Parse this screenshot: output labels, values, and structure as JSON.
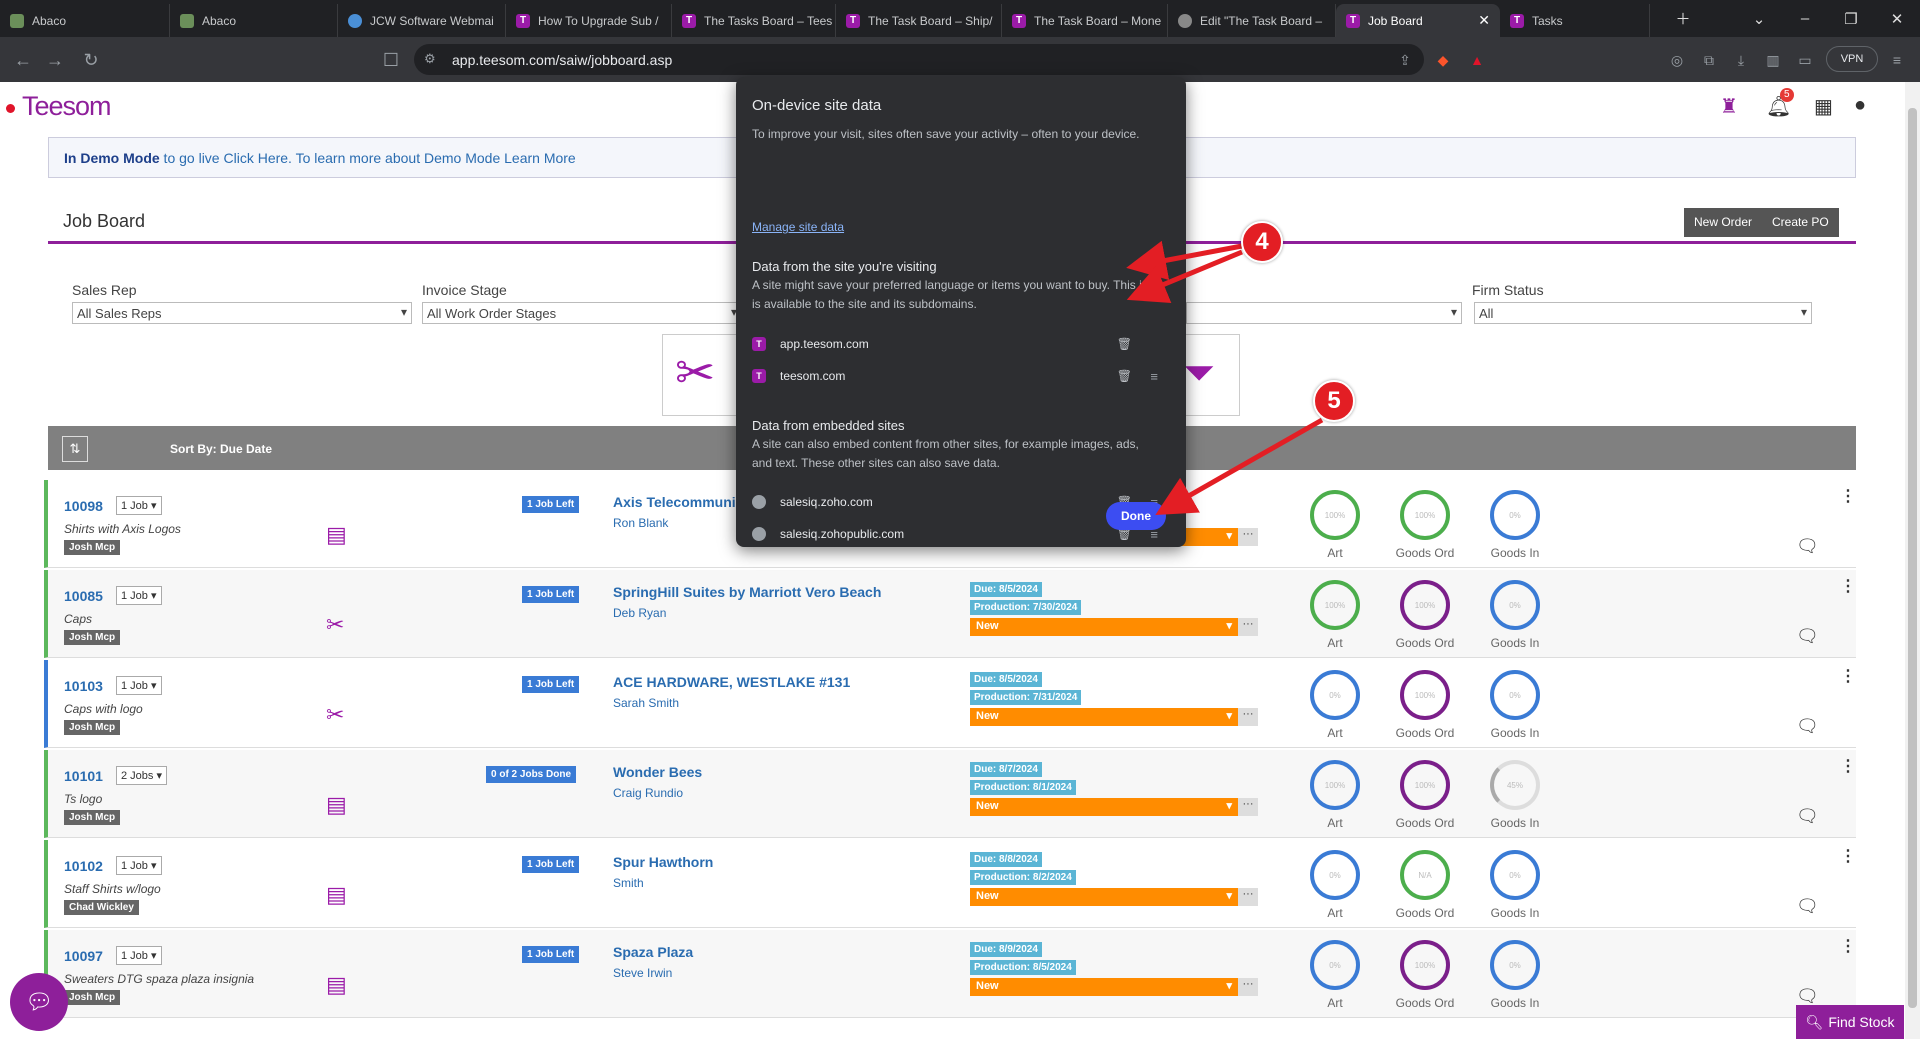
{
  "browser": {
    "tabs": [
      {
        "label": "Abaco",
        "icon": "g"
      },
      {
        "label": "Abaco",
        "icon": "g"
      },
      {
        "label": "JCW Software Webmai",
        "icon": "w"
      },
      {
        "label": "How To Upgrade Sub /",
        "icon": "t"
      },
      {
        "label": "The Tasks Board – Tees",
        "icon": "t"
      },
      {
        "label": "The Task Board – Ship/",
        "icon": "t"
      },
      {
        "label": "The Task Board – Mone",
        "icon": "t"
      },
      {
        "label": "Edit \"The Task Board –",
        "icon": "gl"
      },
      {
        "label": "Job Board",
        "icon": "t",
        "active": true
      },
      {
        "label": "Tasks",
        "icon": "t"
      }
    ],
    "url": "app.teesom.com/saiw/jobboard.asp",
    "vpn": "VPN"
  },
  "app": {
    "logo": "Teesom",
    "bell_count": "5",
    "demo": {
      "bold": "In Demo Mode",
      "rest": " to go live Click Here. To learn more about Demo Mode Learn More"
    },
    "title": "Job Board",
    "buttons": {
      "new_order": "New Order",
      "create_po": "Create PO"
    },
    "filters": {
      "sales_rep": {
        "label": "Sales Rep",
        "value": "All Sales Reps"
      },
      "invoice_stage": {
        "label": "Invoice Stage",
        "value": "All Work Order Stages"
      },
      "firm_status": {
        "label": "Firm Status",
        "value": "All"
      }
    },
    "sort_by": "Sort By: Due Date",
    "find_stock": "Find Stock"
  },
  "rows": [
    {
      "no": "10098",
      "jobs": "1 Job",
      "desc": "Shirts with Axis Logos",
      "rep": "Josh Mcp",
      "jobs_left": "1 Job Left",
      "customer": "Axis Telecommunic",
      "contact": "Ron Blank",
      "due": "",
      "prod": "",
      "stage": "",
      "rings": [
        {
          "v": "100%",
          "c": "g",
          "l": "Art"
        },
        {
          "v": "100%",
          "c": "g",
          "l": "Goods Ord"
        },
        {
          "v": "0%",
          "c": "b",
          "l": "Goods In"
        }
      ]
    },
    {
      "no": "10085",
      "jobs": "1 Job",
      "desc": "Caps",
      "rep": "Josh Mcp",
      "jobs_left": "1 Job Left",
      "customer": "SpringHill Suites by Marriott Vero Beach",
      "contact": "Deb Ryan",
      "due": "Due: 8/5/2024",
      "prod": "Production: 7/30/2024",
      "stage": "New",
      "rings": [
        {
          "v": "100%",
          "c": "g",
          "l": "Art"
        },
        {
          "v": "100%",
          "c": "p",
          "l": "Goods Ord"
        },
        {
          "v": "0%",
          "c": "b",
          "l": "Goods In"
        }
      ]
    },
    {
      "no": "10103",
      "jobs": "1 Job",
      "desc": "Caps with logo",
      "rep": "Josh Mcp",
      "jobs_left": "1 Job Left",
      "customer": "ACE HARDWARE, WESTLAKE #131",
      "contact": "Sarah Smith",
      "due": "Due: 8/5/2024",
      "prod": "Production: 7/31/2024",
      "stage": "New",
      "rings": [
        {
          "v": "0%",
          "c": "b",
          "l": "Art"
        },
        {
          "v": "100%",
          "c": "p",
          "l": "Goods Ord"
        },
        {
          "v": "0%",
          "c": "b",
          "l": "Goods In"
        }
      ]
    },
    {
      "no": "10101",
      "jobs": "2 Jobs",
      "desc": "Ts logo",
      "rep": "Josh Mcp",
      "jobs_left": "0 of 2 Jobs Done",
      "customer": "Wonder Bees",
      "contact": "Craig Rundio",
      "due": "Due: 8/7/2024",
      "prod": "Production: 8/1/2024",
      "stage": "New",
      "rings": [
        {
          "v": "100%",
          "c": "b",
          "l": "Art"
        },
        {
          "v": "100%",
          "c": "p",
          "l": "Goods Ord"
        },
        {
          "v": "45%",
          "c": "n",
          "l": "Goods In"
        }
      ]
    },
    {
      "no": "10102",
      "jobs": "1 Job",
      "desc": "Staff Shirts w/logo",
      "rep": "Chad Wickley",
      "jobs_left": "1 Job Left",
      "customer": "Spur Hawthorn",
      "contact": "Smith",
      "due": "Due: 8/8/2024",
      "prod": "Production: 8/2/2024",
      "stage": "New",
      "rings": [
        {
          "v": "0%",
          "c": "b",
          "l": "Art"
        },
        {
          "v": "N/A",
          "c": "g",
          "l": "Goods Ord"
        },
        {
          "v": "0%",
          "c": "b",
          "l": "Goods In"
        }
      ]
    },
    {
      "no": "10097",
      "jobs": "1 Job",
      "desc": "Sweaters DTG spaza plaza insignia",
      "rep": "Josh Mcp",
      "jobs_left": "1 Job Left",
      "customer": "Spaza Plaza",
      "contact": "Steve Irwin",
      "due": "Due: 8/9/2024",
      "prod": "Production: 8/5/2024",
      "stage": "New",
      "rings": [
        {
          "v": "0%",
          "c": "b",
          "l": "Art"
        },
        {
          "v": "100%",
          "c": "p",
          "l": "Goods Ord"
        },
        {
          "v": "0%",
          "c": "b",
          "l": "Goods In"
        }
      ]
    }
  ],
  "popup": {
    "title": "On-device site data",
    "intro": "To improve your visit, sites often save your activity – often to your device.",
    "manage": "Manage site data",
    "visiting_heading": "Data from the site you're visiting",
    "visiting_text": "A site might save your preferred language or items you want to buy. This info is available to the site and its subdomains.",
    "visiting_sites": [
      "app.teesom.com",
      "teesom.com"
    ],
    "embedded_heading": "Data from embedded sites",
    "embedded_text": "A site can also embed content from other sites, for example images, ads, and text. These other sites can also save data.",
    "embedded_sites": [
      "salesiq.zoho.com",
      "salesiq.zohopublic.com"
    ],
    "done": "Done"
  },
  "annotations": {
    "a4": "4",
    "a5": "5"
  },
  "colors": {
    "brand": "#8e1f9a",
    "stage": "#ff8c00",
    "done": "#3c4df2",
    "arrow": "#e31e24"
  }
}
